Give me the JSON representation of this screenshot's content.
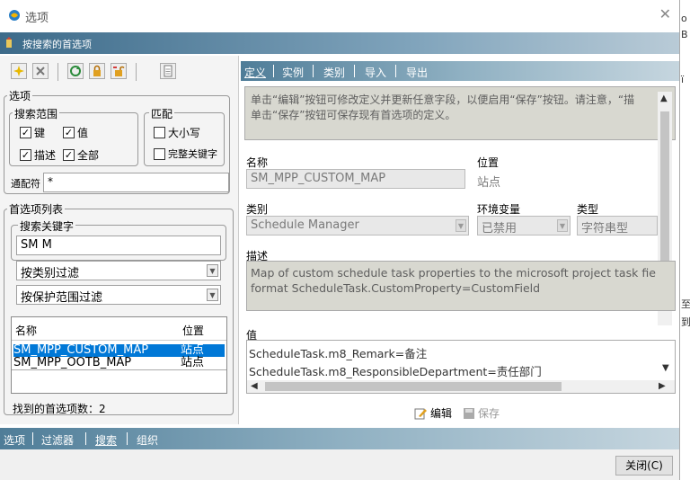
{
  "window": {
    "title": "选项",
    "header_title": "按搜索的首选项"
  },
  "background_text": [
    "o",
    "B",
    "ї",
    "至",
    "到"
  ],
  "left": {
    "options_group": {
      "legend": "选项",
      "search_scope": {
        "legend": "搜索范围",
        "key": "键",
        "value": "值",
        "description": "描述",
        "all": "全部"
      },
      "match": {
        "legend": "匹配",
        "case": "大小写",
        "whole_word": "完整关键字"
      },
      "wildcard_label": "通配符",
      "wildcard_value": "*"
    },
    "pref_list_group": {
      "legend": "首选项列表",
      "search_keyword_legend": "搜索关键字",
      "search_keyword_value": "SM M",
      "category_filter": "按类别过滤",
      "protection_filter": "按保护范围过滤",
      "columns": {
        "name": "名称",
        "location": "位置"
      },
      "rows": [
        {
          "name": "SM_MPP_CUSTOM_MAP",
          "location": "站点"
        },
        {
          "name": "SM_MPP_OOTB_MAP",
          "location": "站点"
        }
      ],
      "found_label": "找到的首选项数：2"
    }
  },
  "right": {
    "tabs": [
      "定义",
      "实例",
      "类别",
      "导入",
      "导出"
    ],
    "help_text_1": "单击“编辑”按钮可修改定义并更新任意字段，以便启用“保存”按钮。请注意，“描",
    "help_text_2": "单击“保存”按钮可保存现有首选项的定义。",
    "name_label": "名称",
    "name_value": "SM_MPP_CUSTOM_MAP",
    "location_label": "位置",
    "location_value": "站点",
    "category_label": "类别",
    "category_value": "Schedule Manager",
    "env_label": "环境变量",
    "env_value": "已禁用",
    "type_label": "类型",
    "type_value": "字符串型",
    "desc_label": "描述",
    "desc_line_1": "Map of custom schedule task properties to the microsoft project task fie",
    "desc_line_2": "format ScheduleTask.CustomProperty=CustomField",
    "value_label": "值",
    "value_line_1": "ScheduleTask.m8_Remark=备注",
    "value_line_2": "ScheduleTask.m8_ResponsibleDepartment=责任部门",
    "edit_button": "编辑",
    "save_button": "保存"
  },
  "bottom_nav": [
    "选项",
    "过滤器",
    "搜索",
    "组织"
  ],
  "footer": {
    "close_button": "关闭(C)"
  },
  "colors": {
    "header_start": "#3d6b8a",
    "tab_start": "#4f7d98",
    "selection": "#0078d7",
    "readonly_bg": "#d8d8d0"
  }
}
